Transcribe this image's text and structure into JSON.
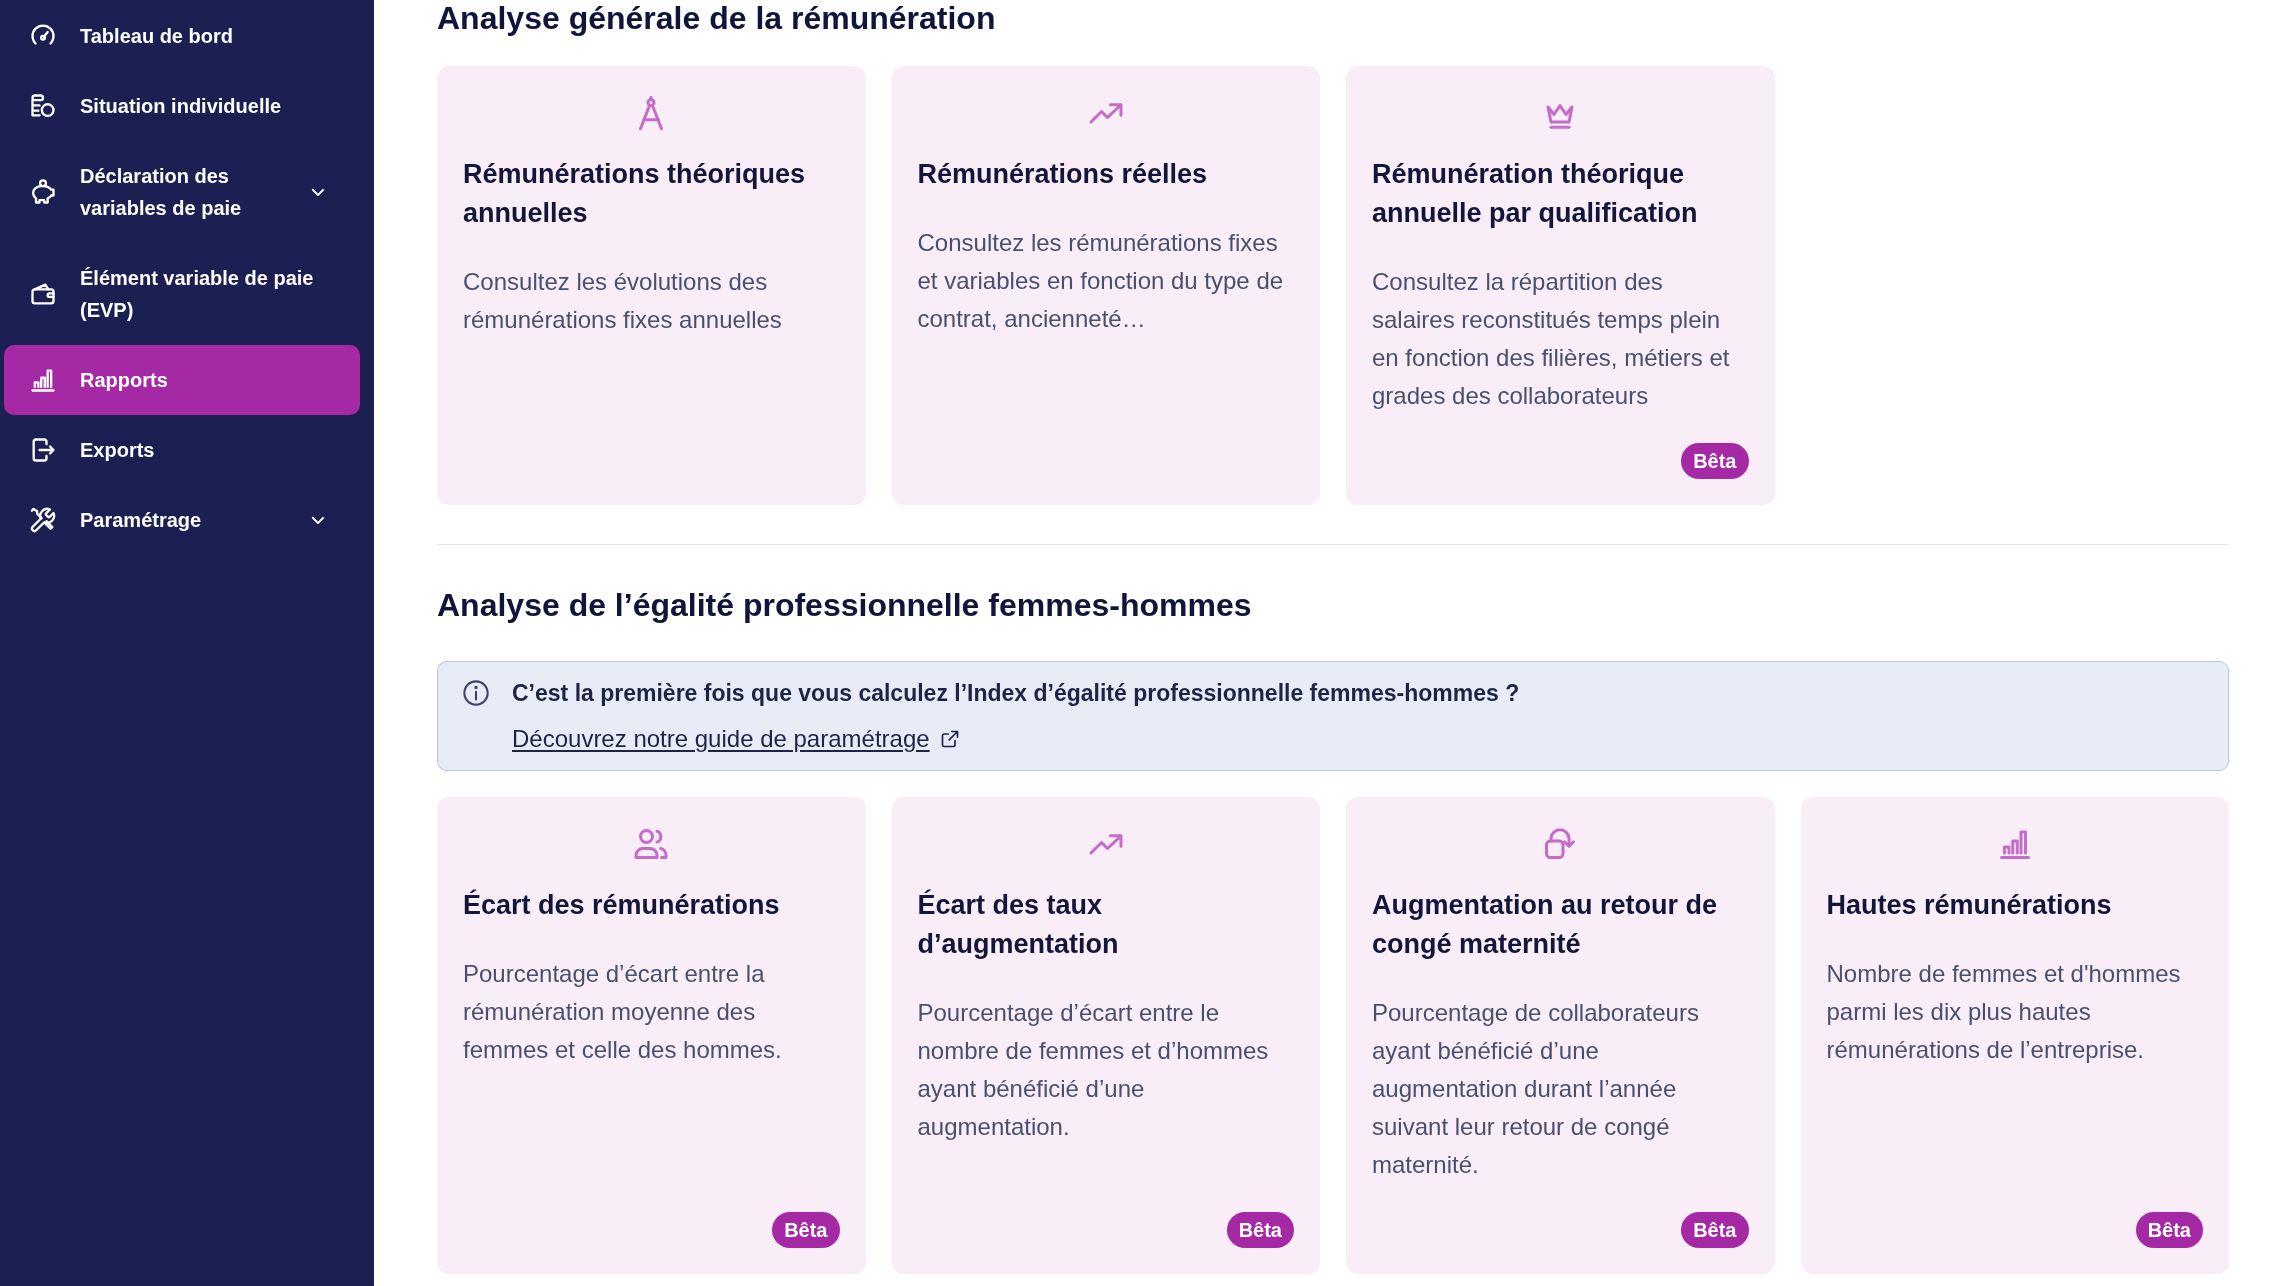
{
  "sidebar": {
    "items": [
      {
        "label": "Tableau de bord",
        "kind": "link",
        "selected": false
      },
      {
        "label": "Situation individuelle",
        "kind": "link",
        "selected": false
      },
      {
        "label": "Déclaration des variables de paie",
        "kind": "group",
        "expanded": false,
        "selected": false
      },
      {
        "label": "Élément variable de paie (EVP)",
        "kind": "link",
        "selected": false
      },
      {
        "label": "Rapports",
        "kind": "link",
        "selected": true
      },
      {
        "label": "Exports",
        "kind": "link",
        "selected": false
      },
      {
        "label": "Paramétrage",
        "kind": "group",
        "expanded": false,
        "selected": false
      }
    ]
  },
  "sections": [
    {
      "title": "Analyse générale de la rémunération",
      "cards": [
        {
          "title": "Rémunérations théoriques annuelles",
          "description": "Consultez les évolutions des rémunérations fixes annuelles"
        },
        {
          "title": "Rémunérations réelles",
          "description": "Consultez les rémunérations fixes et variables en fonction du type de contrat, ancienneté…"
        },
        {
          "title": "Rémunération théorique annuelle par qualification",
          "description": "Consultez la répartition des salaires reconstitués temps plein en fonction des filières, métiers et grades des collaborateurs",
          "badge": "Bêta"
        }
      ]
    },
    {
      "title": "Analyse de l’égalité professionnelle femmes-hommes",
      "notice": {
        "text": "C’est la première fois que vous calculez l’Index d’égalité professionnelle femmes-hommes ?",
        "link": "Découvrez notre guide de paramétrage"
      },
      "cards": [
        {
          "title": "Écart des rémunérations",
          "description": "Pourcentage d’écart entre la rémunération moyenne des femmes et celle des hommes.",
          "badge": "Bêta"
        },
        {
          "title": "Écart des taux d’augmentation",
          "description": "Pourcentage d’écart entre le nombre de femmes et d’hommes ayant bénéficié d’une augmentation.",
          "badge": "Bêta"
        },
        {
          "title": "Augmentation au retour de congé maternité",
          "description": "Pourcentage de collaborateurs ayant bénéficié d’une augmentation durant l’année suivant leur retour de congé maternité.",
          "badge": "Bêta"
        },
        {
          "title": "Hautes rémunérations",
          "description": "Nombre de femmes et d'hommes parmi les dix plus hautes rémunérations de l’entreprise.",
          "badge": "Bêta"
        }
      ]
    }
  ]
}
